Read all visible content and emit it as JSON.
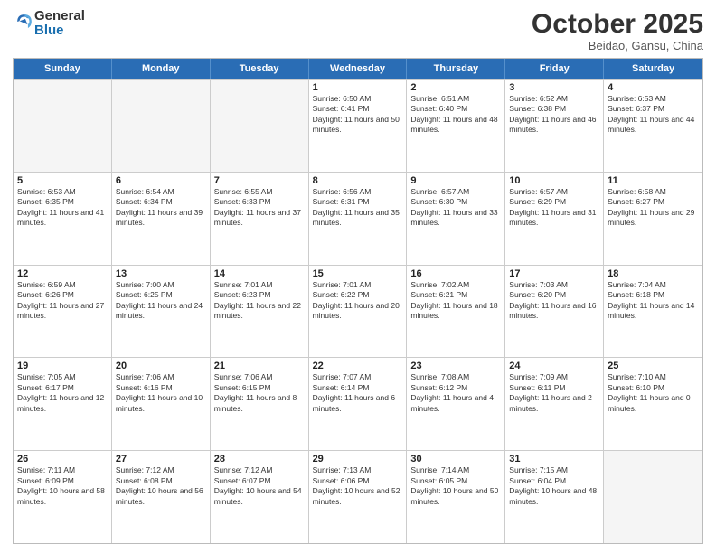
{
  "header": {
    "logo": {
      "general": "General",
      "blue": "Blue"
    },
    "title": "October 2025",
    "location": "Beidao, Gansu, China"
  },
  "weekdays": [
    "Sunday",
    "Monday",
    "Tuesday",
    "Wednesday",
    "Thursday",
    "Friday",
    "Saturday"
  ],
  "rows": [
    [
      {
        "day": "",
        "text": "",
        "empty": true
      },
      {
        "day": "",
        "text": "",
        "empty": true
      },
      {
        "day": "",
        "text": "",
        "empty": true
      },
      {
        "day": "1",
        "text": "Sunrise: 6:50 AM\nSunset: 6:41 PM\nDaylight: 11 hours and 50 minutes.",
        "empty": false
      },
      {
        "day": "2",
        "text": "Sunrise: 6:51 AM\nSunset: 6:40 PM\nDaylight: 11 hours and 48 minutes.",
        "empty": false
      },
      {
        "day": "3",
        "text": "Sunrise: 6:52 AM\nSunset: 6:38 PM\nDaylight: 11 hours and 46 minutes.",
        "empty": false
      },
      {
        "day": "4",
        "text": "Sunrise: 6:53 AM\nSunset: 6:37 PM\nDaylight: 11 hours and 44 minutes.",
        "empty": false
      }
    ],
    [
      {
        "day": "5",
        "text": "Sunrise: 6:53 AM\nSunset: 6:35 PM\nDaylight: 11 hours and 41 minutes.",
        "empty": false
      },
      {
        "day": "6",
        "text": "Sunrise: 6:54 AM\nSunset: 6:34 PM\nDaylight: 11 hours and 39 minutes.",
        "empty": false
      },
      {
        "day": "7",
        "text": "Sunrise: 6:55 AM\nSunset: 6:33 PM\nDaylight: 11 hours and 37 minutes.",
        "empty": false
      },
      {
        "day": "8",
        "text": "Sunrise: 6:56 AM\nSunset: 6:31 PM\nDaylight: 11 hours and 35 minutes.",
        "empty": false
      },
      {
        "day": "9",
        "text": "Sunrise: 6:57 AM\nSunset: 6:30 PM\nDaylight: 11 hours and 33 minutes.",
        "empty": false
      },
      {
        "day": "10",
        "text": "Sunrise: 6:57 AM\nSunset: 6:29 PM\nDaylight: 11 hours and 31 minutes.",
        "empty": false
      },
      {
        "day": "11",
        "text": "Sunrise: 6:58 AM\nSunset: 6:27 PM\nDaylight: 11 hours and 29 minutes.",
        "empty": false
      }
    ],
    [
      {
        "day": "12",
        "text": "Sunrise: 6:59 AM\nSunset: 6:26 PM\nDaylight: 11 hours and 27 minutes.",
        "empty": false
      },
      {
        "day": "13",
        "text": "Sunrise: 7:00 AM\nSunset: 6:25 PM\nDaylight: 11 hours and 24 minutes.",
        "empty": false
      },
      {
        "day": "14",
        "text": "Sunrise: 7:01 AM\nSunset: 6:23 PM\nDaylight: 11 hours and 22 minutes.",
        "empty": false
      },
      {
        "day": "15",
        "text": "Sunrise: 7:01 AM\nSunset: 6:22 PM\nDaylight: 11 hours and 20 minutes.",
        "empty": false
      },
      {
        "day": "16",
        "text": "Sunrise: 7:02 AM\nSunset: 6:21 PM\nDaylight: 11 hours and 18 minutes.",
        "empty": false
      },
      {
        "day": "17",
        "text": "Sunrise: 7:03 AM\nSunset: 6:20 PM\nDaylight: 11 hours and 16 minutes.",
        "empty": false
      },
      {
        "day": "18",
        "text": "Sunrise: 7:04 AM\nSunset: 6:18 PM\nDaylight: 11 hours and 14 minutes.",
        "empty": false
      }
    ],
    [
      {
        "day": "19",
        "text": "Sunrise: 7:05 AM\nSunset: 6:17 PM\nDaylight: 11 hours and 12 minutes.",
        "empty": false
      },
      {
        "day": "20",
        "text": "Sunrise: 7:06 AM\nSunset: 6:16 PM\nDaylight: 11 hours and 10 minutes.",
        "empty": false
      },
      {
        "day": "21",
        "text": "Sunrise: 7:06 AM\nSunset: 6:15 PM\nDaylight: 11 hours and 8 minutes.",
        "empty": false
      },
      {
        "day": "22",
        "text": "Sunrise: 7:07 AM\nSunset: 6:14 PM\nDaylight: 11 hours and 6 minutes.",
        "empty": false
      },
      {
        "day": "23",
        "text": "Sunrise: 7:08 AM\nSunset: 6:12 PM\nDaylight: 11 hours and 4 minutes.",
        "empty": false
      },
      {
        "day": "24",
        "text": "Sunrise: 7:09 AM\nSunset: 6:11 PM\nDaylight: 11 hours and 2 minutes.",
        "empty": false
      },
      {
        "day": "25",
        "text": "Sunrise: 7:10 AM\nSunset: 6:10 PM\nDaylight: 11 hours and 0 minutes.",
        "empty": false
      }
    ],
    [
      {
        "day": "26",
        "text": "Sunrise: 7:11 AM\nSunset: 6:09 PM\nDaylight: 10 hours and 58 minutes.",
        "empty": false
      },
      {
        "day": "27",
        "text": "Sunrise: 7:12 AM\nSunset: 6:08 PM\nDaylight: 10 hours and 56 minutes.",
        "empty": false
      },
      {
        "day": "28",
        "text": "Sunrise: 7:12 AM\nSunset: 6:07 PM\nDaylight: 10 hours and 54 minutes.",
        "empty": false
      },
      {
        "day": "29",
        "text": "Sunrise: 7:13 AM\nSunset: 6:06 PM\nDaylight: 10 hours and 52 minutes.",
        "empty": false
      },
      {
        "day": "30",
        "text": "Sunrise: 7:14 AM\nSunset: 6:05 PM\nDaylight: 10 hours and 50 minutes.",
        "empty": false
      },
      {
        "day": "31",
        "text": "Sunrise: 7:15 AM\nSunset: 6:04 PM\nDaylight: 10 hours and 48 minutes.",
        "empty": false
      },
      {
        "day": "",
        "text": "",
        "empty": true
      }
    ]
  ]
}
